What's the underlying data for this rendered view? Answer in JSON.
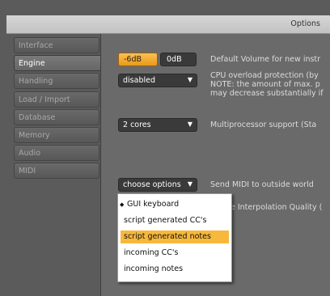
{
  "window": {
    "title": "Options"
  },
  "sidebar": {
    "items": [
      {
        "label": "Interface",
        "active": false
      },
      {
        "label": "Engine",
        "active": true
      },
      {
        "label": "Handling",
        "active": false
      },
      {
        "label": "Load / Import",
        "active": false
      },
      {
        "label": "Database",
        "active": false
      },
      {
        "label": "Memory",
        "active": false
      },
      {
        "label": "Audio",
        "active": false
      },
      {
        "label": "MIDI",
        "active": false
      }
    ]
  },
  "engine": {
    "volume": {
      "minus6_label": "-6dB",
      "zero_label": "0dB",
      "selected": "-6dB",
      "description": "Default Volume for new instr"
    },
    "cpu": {
      "value": "disabled",
      "desc1": "CPU overload protection (by",
      "desc2": "NOTE: the amount of max. p",
      "desc3": "may decrease substantially if"
    },
    "multiprocessor": {
      "value": "2 cores",
      "description": "Multiprocessor support  (Sta"
    },
    "midi_out": {
      "value": "choose options",
      "description": "Send MIDI to outside world"
    },
    "interpolation": {
      "description_visible": "e Interpolation Quality ("
    }
  },
  "midi_menu": {
    "items": [
      {
        "label": "GUI keyboard",
        "checked": true,
        "highlighted": false
      },
      {
        "label": "script generated CC's",
        "checked": false,
        "highlighted": false
      },
      {
        "label": "script generated notes",
        "checked": false,
        "highlighted": true
      },
      {
        "label": "incoming CC's",
        "checked": false,
        "highlighted": false
      },
      {
        "label": "incoming notes",
        "checked": false,
        "highlighted": false
      }
    ]
  },
  "colors": {
    "accent": "#f7b83c",
    "panel": "#6a6a6a",
    "background": "#5b5b5b"
  }
}
